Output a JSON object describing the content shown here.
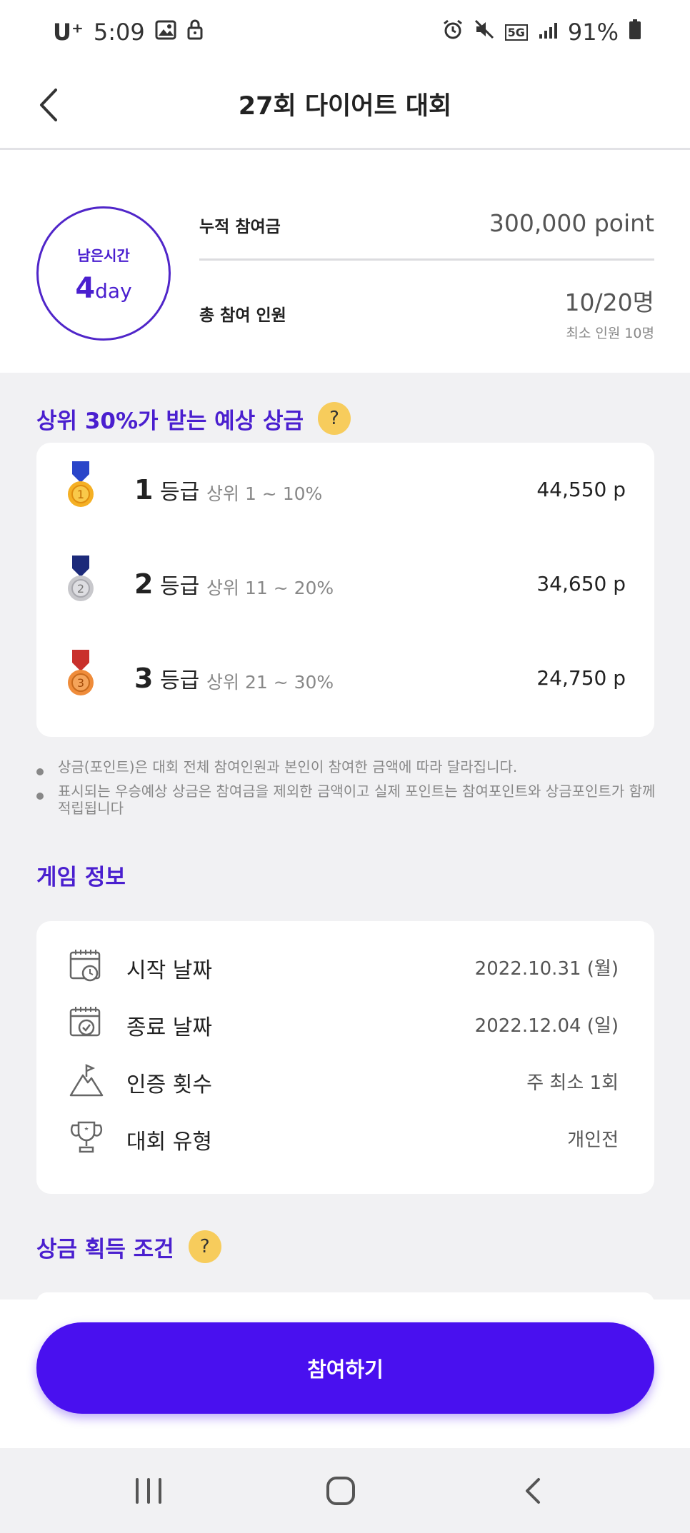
{
  "status_bar": {
    "carrier": "U⁺",
    "time": "5:09",
    "network": "5G",
    "battery": "91%"
  },
  "header": {
    "title": "27회 다이어트 대회"
  },
  "summary": {
    "remaining_label": "남은시간",
    "remaining_number": "4",
    "remaining_unit": "day",
    "total_fee_label": "누적 참여금",
    "total_fee_value": "300,000 point",
    "participants_label": "총 참여 인원",
    "participants_value": "10/20명",
    "min_participants": "최소 인원 10명"
  },
  "prize_section": {
    "title": "상위 30%가 받는 예상 상금",
    "help": "?",
    "rows": [
      {
        "grade": "1",
        "grade_unit": "등급",
        "range": "상위 1 ~ 10%",
        "amount": "44,550 p",
        "medal_color": "#f5b024",
        "ribbon_color": "#2a45c9"
      },
      {
        "grade": "2",
        "grade_unit": "등급",
        "range": "상위 11 ~ 20%",
        "amount": "34,650 p",
        "medal_color": "#c8c8cc",
        "ribbon_color": "#1c2a7a"
      },
      {
        "grade": "3",
        "grade_unit": "등급",
        "range": "상위 21 ~ 30%",
        "amount": "24,750 p",
        "medal_color": "#ef8c3a",
        "ribbon_color": "#c9302c"
      }
    ],
    "notes": [
      "상금(포인트)은 대회 전체 참여인원과 본인이 참여한 금액에 따라 달라집니다.",
      "표시되는 우승예상 상금은 참여금을 제외한 금액이고 실제 포인트는 참여포인트와 상금포인트가 함께 적립됩니다"
    ]
  },
  "game_info": {
    "title": "게임 정보",
    "rows": [
      {
        "icon": "calendar-clock-icon",
        "label": "시작 날짜",
        "value": "2022.10.31 (월)"
      },
      {
        "icon": "calendar-check-icon",
        "label": "종료 날짜",
        "value": "2022.12.04 (일)"
      },
      {
        "icon": "mountain-flag-icon",
        "label": "인증 횟수",
        "value": "주 최소 1회"
      },
      {
        "icon": "trophy-icon",
        "label": "대회 유형",
        "value": "개인전"
      }
    ]
  },
  "award_condition": {
    "title": "상금 획득 조건",
    "help": "?"
  },
  "cta": {
    "join_label": "참여하기"
  },
  "colors": {
    "accent": "#4a1fcf",
    "button": "#4910ef",
    "help_badge": "#f7cc5c",
    "background": "#f1f1f3"
  }
}
